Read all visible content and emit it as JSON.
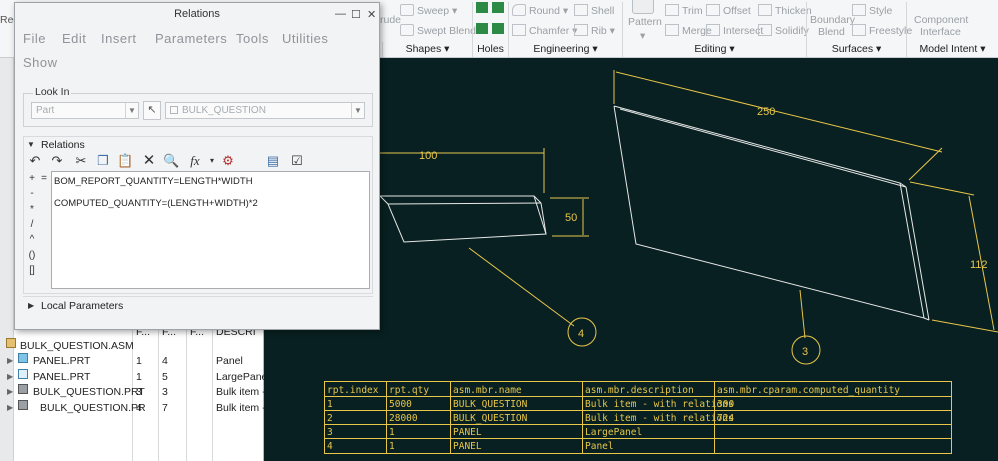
{
  "ribbon": {
    "left_cut_label": "Reg",
    "rows": [
      {
        "label": "rude"
      },
      {
        "label": "Sweep"
      },
      {
        "label": "Swept Blend"
      },
      {
        "label": "Round"
      },
      {
        "label": "Chamfer"
      },
      {
        "label": "Shell"
      },
      {
        "label": "Rib"
      },
      {
        "label": "Pattern"
      },
      {
        "label": "Trim"
      },
      {
        "label": "Offset"
      },
      {
        "label": "Thicken"
      },
      {
        "label": "Merge"
      },
      {
        "label": "Intersect"
      },
      {
        "label": "Solidify"
      },
      {
        "label": "Boundary"
      },
      {
        "label": "Blend"
      },
      {
        "label": "Style"
      },
      {
        "label": "Freestyle"
      },
      {
        "label": "Component"
      },
      {
        "label": "Interface"
      }
    ],
    "groups": [
      {
        "label": "Shapes ▾"
      },
      {
        "label": "Holes"
      },
      {
        "label": "Engineering ▾"
      },
      {
        "label": "Editing ▾"
      },
      {
        "label": "Surfaces ▾"
      },
      {
        "label": "Model Intent ▾"
      }
    ]
  },
  "dialog": {
    "title": "Relations",
    "menus": [
      "File",
      "Edit",
      "Insert",
      "Parameters",
      "Tools",
      "Utilities",
      "Show"
    ],
    "look_in": {
      "legend": "Look In",
      "type_value": "Part",
      "object_value": "BULK_QUESTION"
    },
    "relations_section": "Relations",
    "operators": [
      "+",
      "-",
      "*",
      "/",
      "^",
      "()",
      "[]"
    ],
    "equals_op": "=",
    "relations": [
      "BOM_REPORT_QUANTITY=LENGTH*WIDTH",
      "COMPUTED_QUANTITY=(LENGTH+WIDTH)*2"
    ],
    "local_params": "Local Parameters"
  },
  "tree": {
    "headers": [
      "F...",
      "F...",
      "F...",
      "DESCRI"
    ],
    "root": "BULK_QUESTION.ASM",
    "rows": [
      {
        "name": "PANEL.PRT",
        "c1": "1",
        "c2": "4",
        "desc": "Panel"
      },
      {
        "name": "PANEL.PRT",
        "c1": "1",
        "c2": "5",
        "desc": "LargePanel"
      },
      {
        "name": "BULK_QUESTION.PRT",
        "c1": "3",
        "c2": "3",
        "desc": "Bulk item - v"
      },
      {
        "name": "BULK_QUESTION.PR",
        "c1": "4",
        "c2": "7",
        "desc": "Bulk item - v"
      }
    ]
  },
  "drawing": {
    "dims": {
      "small_len": "100",
      "small_thk": "50",
      "big_len": "250",
      "big_wid": "112"
    },
    "balloons": [
      "4",
      "3"
    ],
    "table": {
      "headers": [
        "rpt.index",
        "rpt.qty",
        "asm.mbr.name",
        "asm.mbr.description",
        "asm.mbr.cparam.computed_quantity"
      ],
      "rows": [
        [
          "1",
          "5000",
          "BULK_QUESTION",
          "Bulk item - with relations",
          "300"
        ],
        [
          "2",
          "28000",
          "BULK_QUESTION",
          "Bulk item - with relations",
          "724"
        ],
        [
          "3",
          "1",
          "PANEL",
          "LargePanel",
          ""
        ],
        [
          "4",
          "1",
          "PANEL",
          "Panel",
          ""
        ]
      ]
    }
  },
  "colors": {
    "graphics_bg": "#082021",
    "drawing_line": "#e8e8e8",
    "dimension": "#e8c64a",
    "table_text": "#e8c64a"
  }
}
